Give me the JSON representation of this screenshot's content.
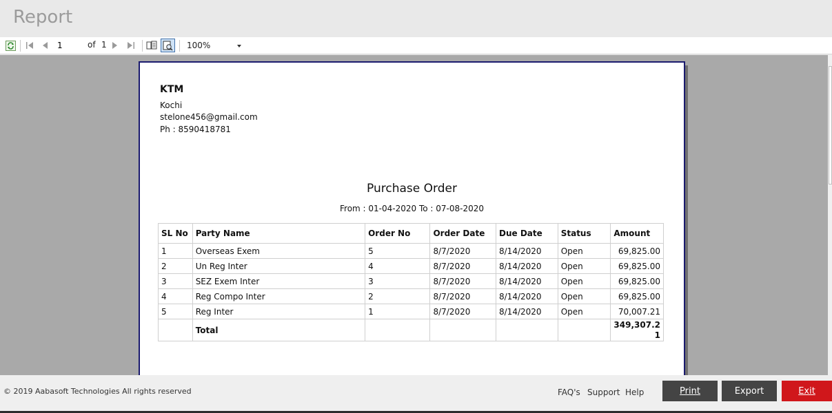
{
  "window": {
    "title": "Report"
  },
  "toolbar": {
    "current_page": "1",
    "of_label": "of",
    "total_pages": "1",
    "zoom": "100%",
    "icons": [
      "refresh-icon",
      "first-page-icon",
      "prev-page-icon",
      "next-page-icon",
      "last-page-icon",
      "print-layout-icon",
      "page-setup-icon"
    ]
  },
  "report": {
    "company": "KTM",
    "address_lines": [
      "Kochi",
      "stelone456@gmail.com",
      "Ph : 8590418781"
    ],
    "title": "Purchase Order",
    "range": "From : 01-04-2020 To : 07-08-2020",
    "columns": [
      "SL No",
      "Party Name",
      "Order No",
      "Order Date",
      "Due Date",
      "Status",
      "Amount"
    ],
    "rows": [
      [
        "1",
        "Overseas Exem",
        "5",
        "8/7/2020",
        "8/14/2020",
        "Open",
        "69,825.00"
      ],
      [
        "2",
        "Un Reg Inter",
        "4",
        "8/7/2020",
        "8/14/2020",
        "Open",
        "69,825.00"
      ],
      [
        "3",
        "SEZ Exem Inter",
        "3",
        "8/7/2020",
        "8/14/2020",
        "Open",
        "69,825.00"
      ],
      [
        "4",
        "Reg Compo Inter",
        "2",
        "8/7/2020",
        "8/14/2020",
        "Open",
        "69,825.00"
      ],
      [
        "5",
        "Reg Inter",
        "1",
        "8/7/2020",
        "8/14/2020",
        "Open",
        "70,007.21"
      ]
    ],
    "total_label": "Total",
    "total_amount_line1": "349,307.2",
    "total_amount_line2": "1"
  },
  "footer": {
    "copyright": "© 2019 Aabasoft Technologies All rights reserved",
    "links": [
      "FAQ's",
      "Support",
      "Help"
    ],
    "print_label": "Print",
    "export_label": "Export",
    "exit_label": "Exit",
    "colors": {
      "dark_button": "#444444",
      "exit_button": "#d0171b"
    }
  }
}
